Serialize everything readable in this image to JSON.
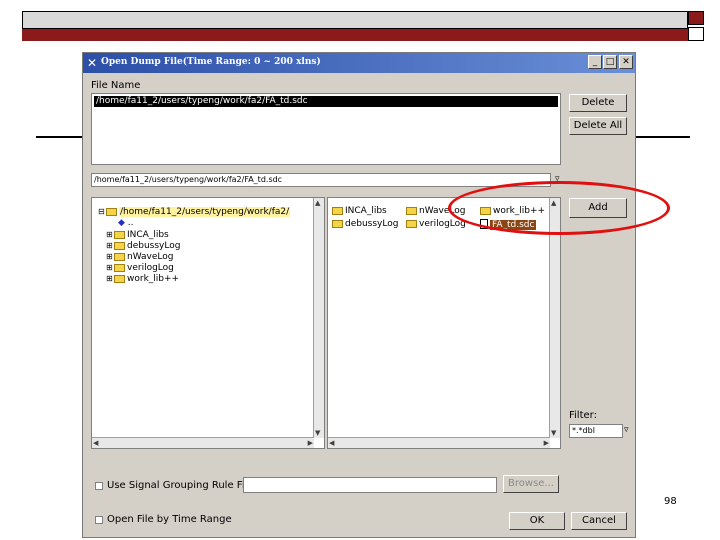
{
  "window": {
    "title": "Open Dump File(Time Range: 0 ~ 200 xlns)"
  },
  "file_name": {
    "label": "File Name",
    "selected_path": "/home/fa11_2/users/typeng/work/fa2/FA_td.sdc"
  },
  "buttons": {
    "delete": "Delete",
    "delete_all": "Delete All",
    "add": "Add",
    "browse": "Browse...",
    "ok": "OK",
    "cancel": "Cancel"
  },
  "path_field": {
    "value": "/home/fa11_2/users/typeng/work/fa2/FA_td.sdc"
  },
  "tree": {
    "root": "/home/fa11_2/users/typeng/work/fa2/",
    "up": "..",
    "items": [
      "INCA_libs",
      "debussyLog",
      "nWaveLog",
      "verilogLog",
      "work_lib++"
    ]
  },
  "files": {
    "items": [
      {
        "name": "INCA_libs",
        "type": "folder"
      },
      {
        "name": "nWaveLog",
        "type": "folder"
      },
      {
        "name": "work_lib++",
        "type": "folder"
      },
      {
        "name": "debussyLog",
        "type": "folder"
      },
      {
        "name": "verilogLog",
        "type": "folder"
      },
      {
        "name": "FA_td.sdc",
        "type": "file"
      }
    ]
  },
  "filter": {
    "label": "Filter:",
    "value": "*.*dbl"
  },
  "options": {
    "signal_grouping": "Use Signal Grouping Rule File:",
    "time_range": "Open File by Time Range"
  },
  "slide": {
    "page_number": "98"
  },
  "colors": {
    "title_bar": "#2c4fa8",
    "dialog_bg": "#d4d0c8",
    "highlight_circle": "#e01010",
    "selected_file": "#8b4513",
    "slide_bar": "#8b1a1a"
  }
}
